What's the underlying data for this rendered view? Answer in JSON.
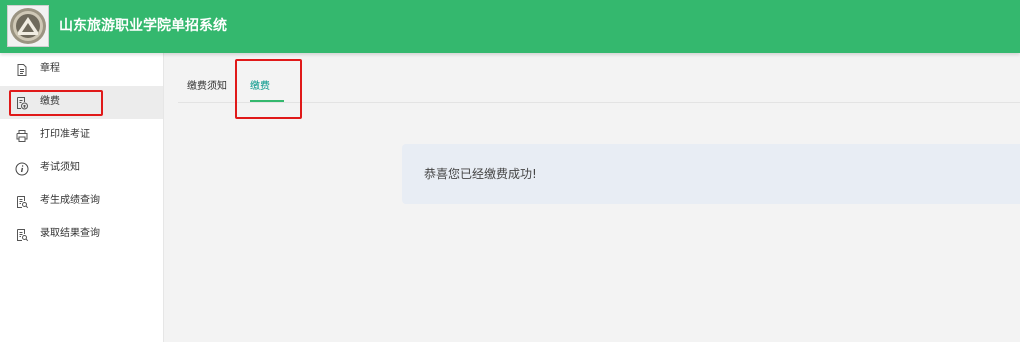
{
  "header": {
    "title": "山东旅游职业学院单招系统",
    "logo_icon": "school-seal-logo",
    "background": "#34b86e"
  },
  "sidebar": {
    "items": [
      {
        "label": "章程",
        "icon": "document-icon",
        "active": false
      },
      {
        "label": "缴费",
        "icon": "payment-icon",
        "active": true
      },
      {
        "label": "打印准考证",
        "icon": "printer-icon",
        "active": false
      },
      {
        "label": "考试须知",
        "icon": "info-icon",
        "active": false
      },
      {
        "label": "考生成绩查询",
        "icon": "score-query-icon",
        "active": false
      },
      {
        "label": "录取结果查询",
        "icon": "admission-query-icon",
        "active": false
      }
    ]
  },
  "tabs": [
    {
      "label": "缴费须知",
      "active": false
    },
    {
      "label": "缴费",
      "active": true
    }
  ],
  "message": {
    "text": "恭喜您已经缴费成功!"
  },
  "colors": {
    "accent": "#34b86e",
    "active_tab_text": "#009688",
    "highlight": "#e01919"
  }
}
